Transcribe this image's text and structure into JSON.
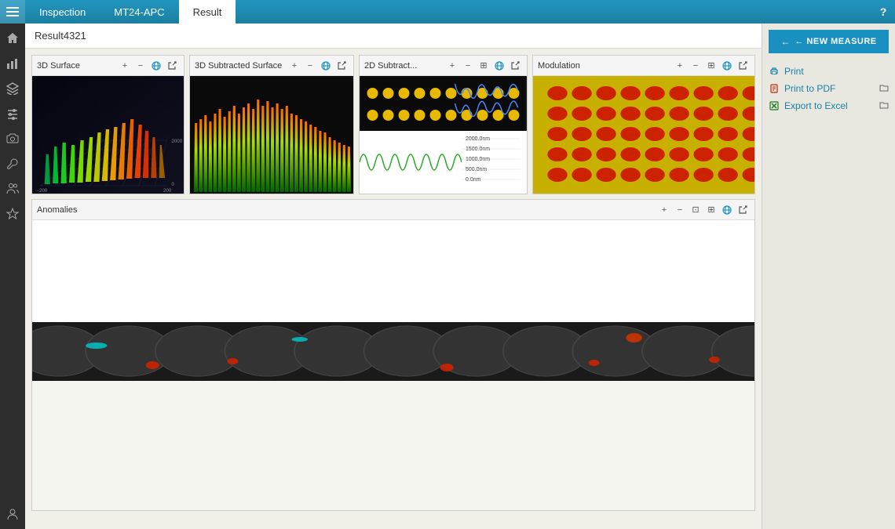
{
  "topbar": {
    "tabs": [
      {
        "label": "Inspection",
        "active": false
      },
      {
        "label": "MT24-APC",
        "active": false
      },
      {
        "label": "Result",
        "active": true
      }
    ],
    "help_label": "?"
  },
  "result_header": {
    "title": "Result4321"
  },
  "panels": {
    "surface3d": {
      "title": "3D Surface"
    },
    "subtracted3d": {
      "title": "3D Subtracted Surface"
    },
    "subtracted2d": {
      "title": "2D Subtract..."
    },
    "modulation": {
      "title": "Modulation"
    },
    "anomalies": {
      "title": "Anomalies"
    }
  },
  "toolbar": {
    "zoom_in": "+",
    "zoom_out": "−",
    "zoom_fit": "⊡",
    "settings": "⊞",
    "export": "⇗"
  },
  "right_panel": {
    "new_measure_label": "← NEW MEASURE",
    "actions": [
      {
        "icon": "print",
        "label": "Print",
        "has_folder": false
      },
      {
        "icon": "pdf",
        "label": "Print to PDF",
        "has_folder": true
      },
      {
        "icon": "excel",
        "label": "Export to Excel",
        "has_folder": true
      }
    ]
  },
  "sidebar": {
    "icons": [
      "home",
      "chart",
      "layers",
      "sliders",
      "camera",
      "tools",
      "people",
      "star",
      "user"
    ]
  }
}
